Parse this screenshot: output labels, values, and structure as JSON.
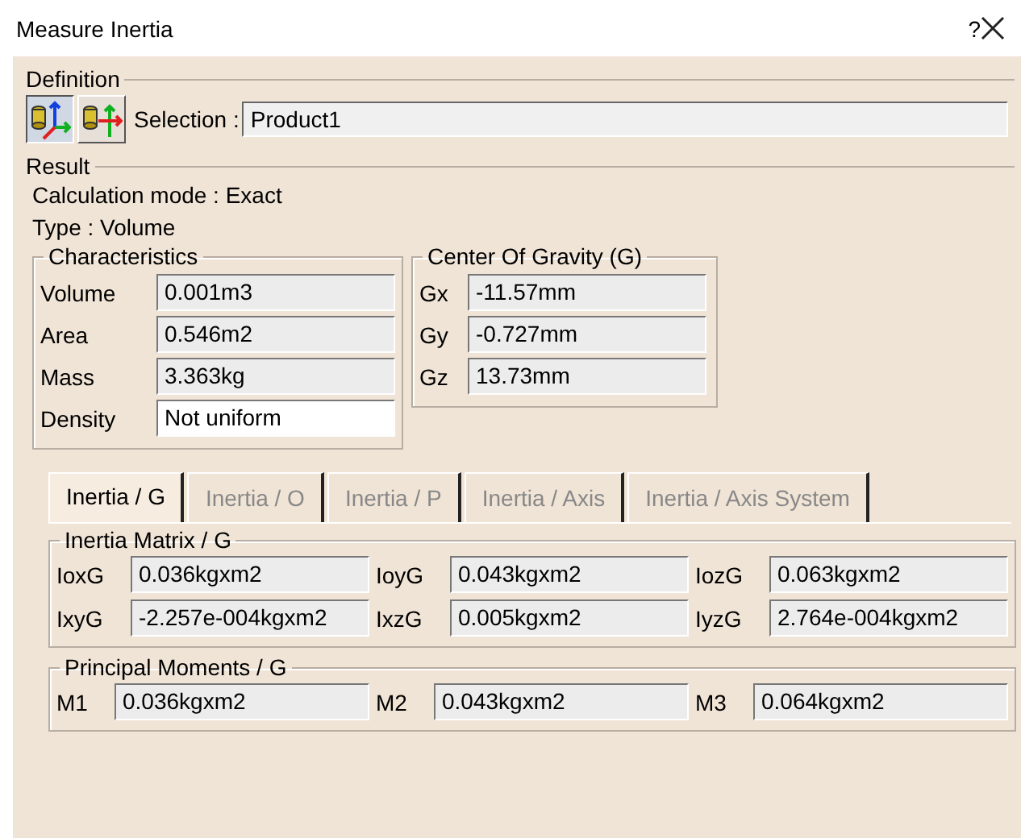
{
  "window": {
    "title": "Measure Inertia",
    "help": "?"
  },
  "definition": {
    "title": "Definition",
    "tools": [
      {
        "selected": true
      },
      {
        "selected": false
      }
    ],
    "selection_label": "Selection :",
    "selection_value": "Product1"
  },
  "result": {
    "title": "Result",
    "calculation_mode": "Calculation mode : Exact",
    "type": "Type : Volume"
  },
  "characteristics": {
    "title": "Characteristics",
    "fields": [
      {
        "label": "Volume",
        "value": "0.001m3",
        "readonly": true
      },
      {
        "label": "Area",
        "value": "0.546m2",
        "readonly": true
      },
      {
        "label": "Mass",
        "value": "3.363kg",
        "readonly": true
      },
      {
        "label": "Density",
        "value": "Not uniform",
        "readonly": false
      }
    ]
  },
  "center_of_gravity": {
    "title": "Center Of Gravity (G)",
    "fields": [
      {
        "label": "Gx",
        "value": "-11.57mm",
        "readonly": true
      },
      {
        "label": "Gy",
        "value": "-0.727mm",
        "readonly": true
      },
      {
        "label": "Gz",
        "value": "13.73mm",
        "readonly": true
      }
    ]
  },
  "tabs": [
    {
      "label": "Inertia / G",
      "selected": true
    },
    {
      "label": "Inertia / O",
      "selected": false
    },
    {
      "label": "Inertia / P",
      "selected": false
    },
    {
      "label": "Inertia / Axis",
      "selected": false
    },
    {
      "label": "Inertia / Axis System",
      "selected": false
    }
  ],
  "inertia_matrix": {
    "title": "Inertia Matrix / G",
    "fields": [
      {
        "label": "IoxG",
        "value": "0.036kgxm2",
        "readonly": true
      },
      {
        "label": "IoyG",
        "value": "0.043kgxm2",
        "readonly": true
      },
      {
        "label": "IozG",
        "value": "0.063kgxm2",
        "readonly": true
      },
      {
        "label": "IxyG",
        "value": "-2.257e-004kgxm2",
        "readonly": true
      },
      {
        "label": "IxzG",
        "value": "0.005kgxm2",
        "readonly": true
      },
      {
        "label": "IyzG",
        "value": "2.764e-004kgxm2",
        "readonly": true
      }
    ]
  },
  "principal_moments": {
    "title": "Principal Moments / G",
    "fields": [
      {
        "label": "M1",
        "value": "0.036kgxm2",
        "readonly": true
      },
      {
        "label": "M2",
        "value": "0.043kgxm2",
        "readonly": true
      },
      {
        "label": "M3",
        "value": "0.064kgxm2",
        "readonly": true
      }
    ]
  }
}
